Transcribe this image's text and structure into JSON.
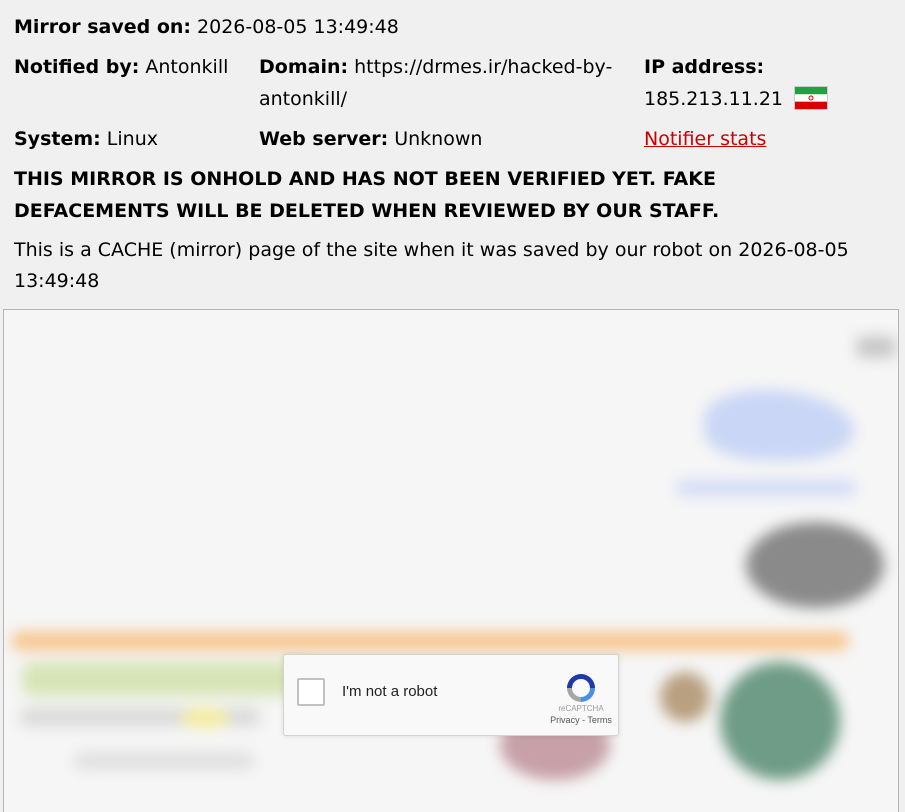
{
  "header": {
    "mirror_saved_label": "Mirror saved on:",
    "mirror_saved_value": "2026-08-05 13:49:48",
    "notified_by_label": "Notified by:",
    "notified_by_value": "Antonkill",
    "domain_label": "Domain:",
    "domain_value_line1": "https://drmes.ir/hacked-by-",
    "domain_value_line2": "antonkill/",
    "ip_label": "IP address:",
    "ip_value": "185.213.11.21",
    "flag_icon": "iran-flag-icon",
    "system_label": "System:",
    "system_value": "Linux",
    "web_server_label": "Web server:",
    "web_server_value": "Unknown",
    "notifier_stats_link": "Notifier stats"
  },
  "warning": {
    "line1": "THIS MIRROR IS ONHOLD AND HAS NOT BEEN VERIFIED YET. FAKE",
    "line2": "DEFACEMENTS WILL BE DELETED WHEN REVIEWED BY OUR STAFF."
  },
  "cache_notice": {
    "line1": "This is a CACHE (mirror) page of the site when it was saved by our robot on 2026-08-05",
    "line2": "13:49:48"
  },
  "recaptcha": {
    "label": "I'm not a robot",
    "brand": "reCAPTCHA",
    "privacy": "Privacy",
    "separator": " - ",
    "terms": "Terms",
    "icon": "recaptcha-logo-icon"
  },
  "colors": {
    "link": "#cc0000",
    "background": "#f0f0f0",
    "frame_border": "#b4b4b4"
  }
}
